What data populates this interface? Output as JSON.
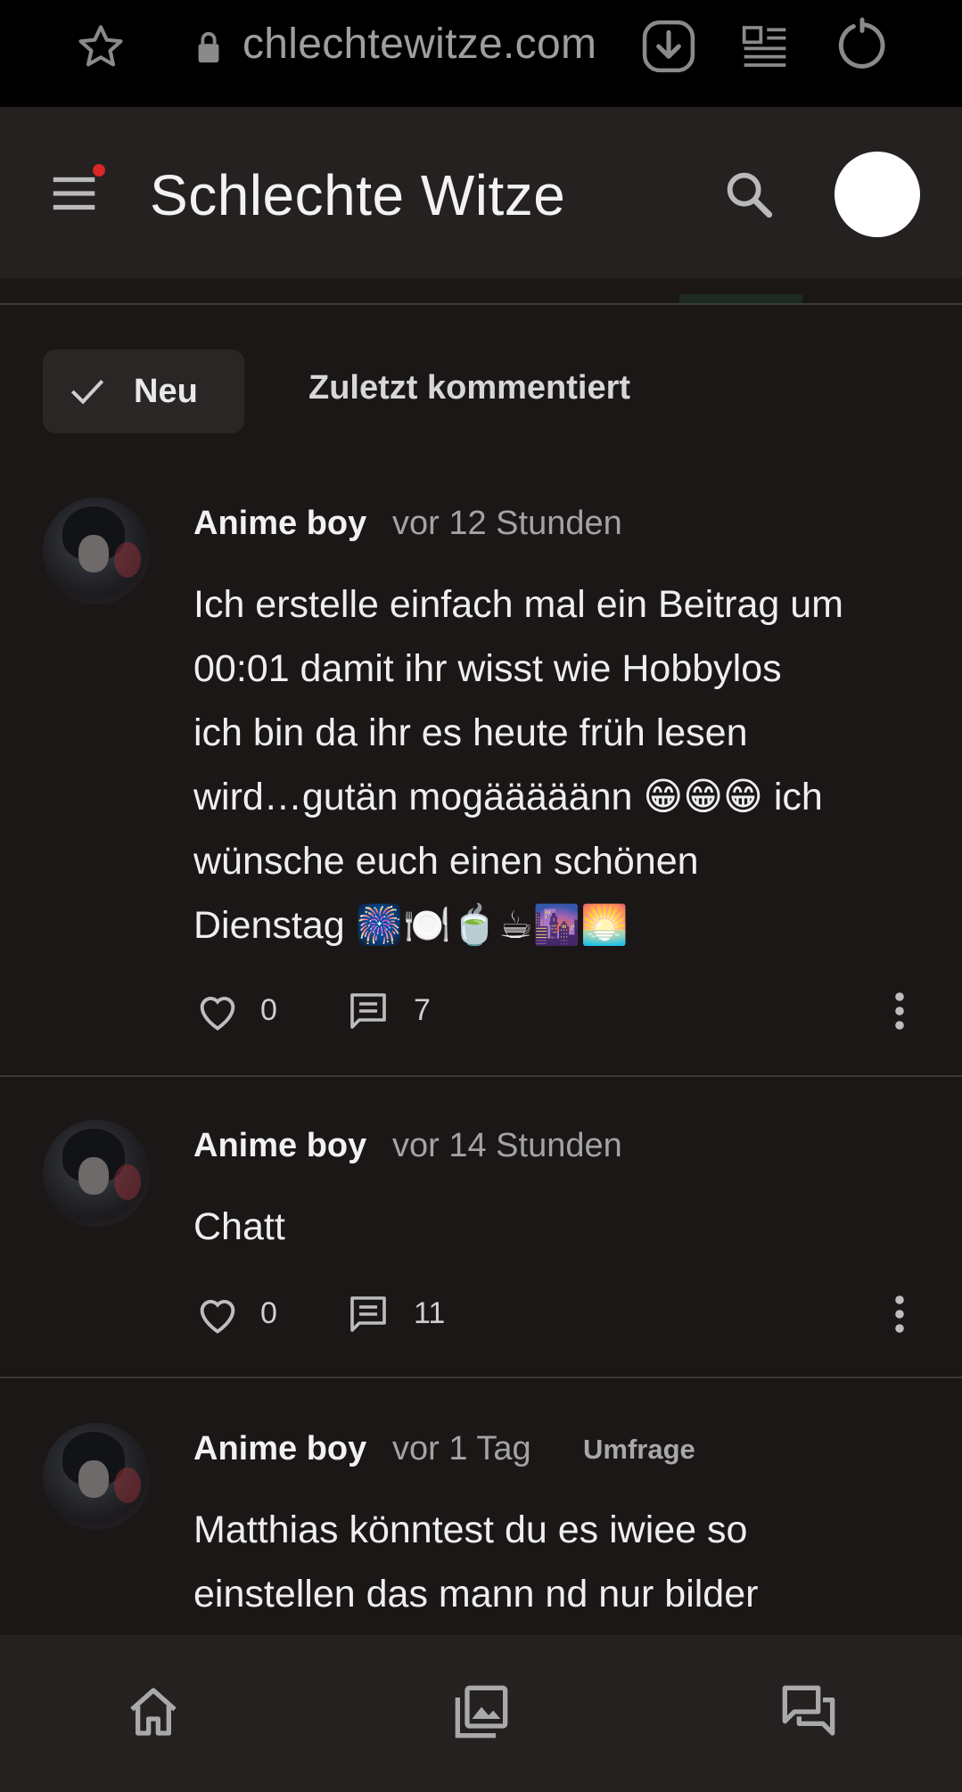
{
  "browser": {
    "url": "chlechtewitze.com",
    "icons": [
      "star-icon",
      "lock-icon",
      "download-icon",
      "reader-mode-icon",
      "reload-icon"
    ]
  },
  "header": {
    "title": "Schlechte Witze",
    "notification_dot_color": "#d8262b",
    "icons": [
      "menu-icon",
      "search-icon"
    ]
  },
  "filters": {
    "active_label": "Neu",
    "other_label": "Zuletzt kommentiert"
  },
  "posts": [
    {
      "author": "Anime boy",
      "time": "vor 12 Stunden",
      "badge": "",
      "text_lines": [
        "Ich erstelle einfach mal ein Beitrag um",
        "00:01 damit ihr wisst wie Hobbylos",
        "ich bin da ihr es heute früh lesen",
        "wird…gutän mogääääänn 😁😁😁 ich",
        "wünsche euch einen schönen",
        "Dienstag 🎆🍽️🍵☕🌆🌅"
      ],
      "likes": "0",
      "comments": "7"
    },
    {
      "author": "Anime boy",
      "time": "vor 14 Stunden",
      "badge": "",
      "text_lines": [
        "Chatt"
      ],
      "likes": "0",
      "comments": "11"
    },
    {
      "author": "Anime boy",
      "time": "vor 1 Tag",
      "badge": "Umfrage",
      "text_lines": [
        "Matthias könntest du es iwiee so",
        "einstellen das mann nd nur bilder"
      ]
    }
  ],
  "bottom_nav": [
    "home-icon",
    "gallery-icon",
    "chat-icon"
  ],
  "colors": {
    "background": "#1a1716",
    "header": "#242120",
    "text": "#eeeeee",
    "muted": "#a3a3a3"
  }
}
